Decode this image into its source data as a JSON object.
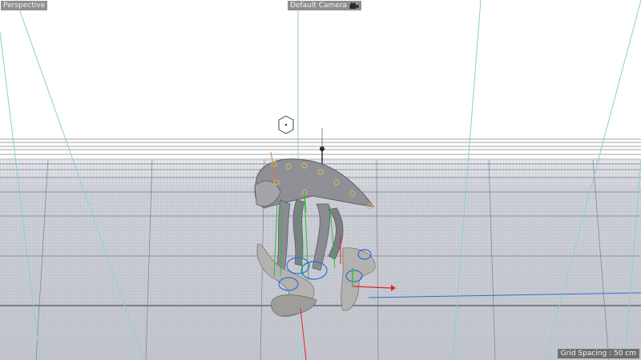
{
  "viewport": {
    "view_mode_label": "Perspective",
    "camera_label": "Default Camera",
    "camera_icon": "camera-icon",
    "grid_spacing_label": "Grid Spacing : 50 cm"
  },
  "colors": {
    "background": "#ffffff",
    "floor": "#c9cbd2",
    "guide_lines": "#8fd0c8",
    "model": "#8e9096",
    "axis_x": "#e0261f",
    "axis_y": "#2ebc37",
    "axis_z": "#2a6fd6",
    "joint": "#d9b35a"
  }
}
